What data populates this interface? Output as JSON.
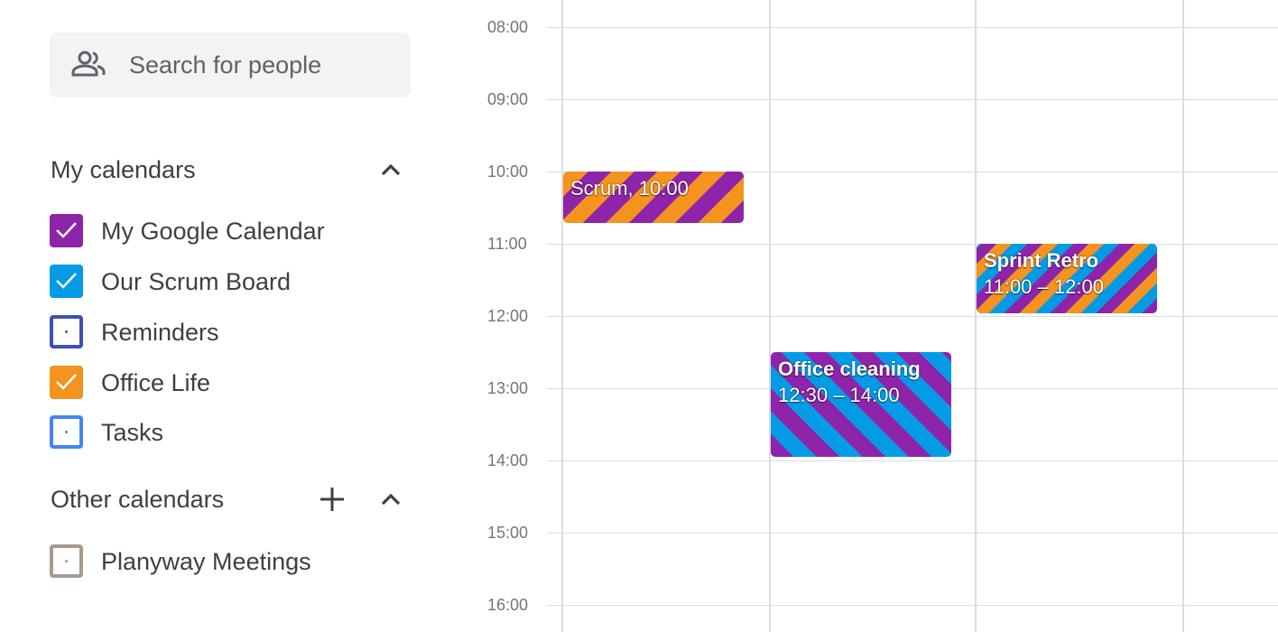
{
  "search": {
    "placeholder": "Search for people"
  },
  "my_calendars": {
    "title": "My calendars",
    "items": [
      {
        "label": "My Google Calendar",
        "color": "#8e24aa",
        "checked": true
      },
      {
        "label": "Our Scrum Board",
        "color": "#039be5",
        "checked": true
      },
      {
        "label": "Reminders",
        "color": "#3f51b5",
        "checked": false
      },
      {
        "label": "Office Life",
        "color": "#f4931e",
        "checked": true
      },
      {
        "label": "Tasks",
        "color": "#4285f4",
        "checked": false
      }
    ]
  },
  "other_calendars": {
    "title": "Other calendars",
    "items": [
      {
        "label": "Planyway Meetings",
        "color": "#a79b8e",
        "checked": false
      }
    ]
  },
  "times": [
    "08:00",
    "09:00",
    "10:00",
    "11:00",
    "12:00",
    "13:00",
    "14:00",
    "15:00",
    "16:00"
  ],
  "events": {
    "scrum": {
      "title": "Scrum, 10:00"
    },
    "cleaning": {
      "title": "Office cleaning",
      "time": "12:30 – 14:00"
    },
    "retro": {
      "title": "Sprint Retro",
      "time": "11:00 – 12:00"
    }
  },
  "icons": {
    "search": "people-icon",
    "collapse": "chevron-up-icon",
    "add": "plus-icon",
    "check": "checkmark-icon"
  }
}
